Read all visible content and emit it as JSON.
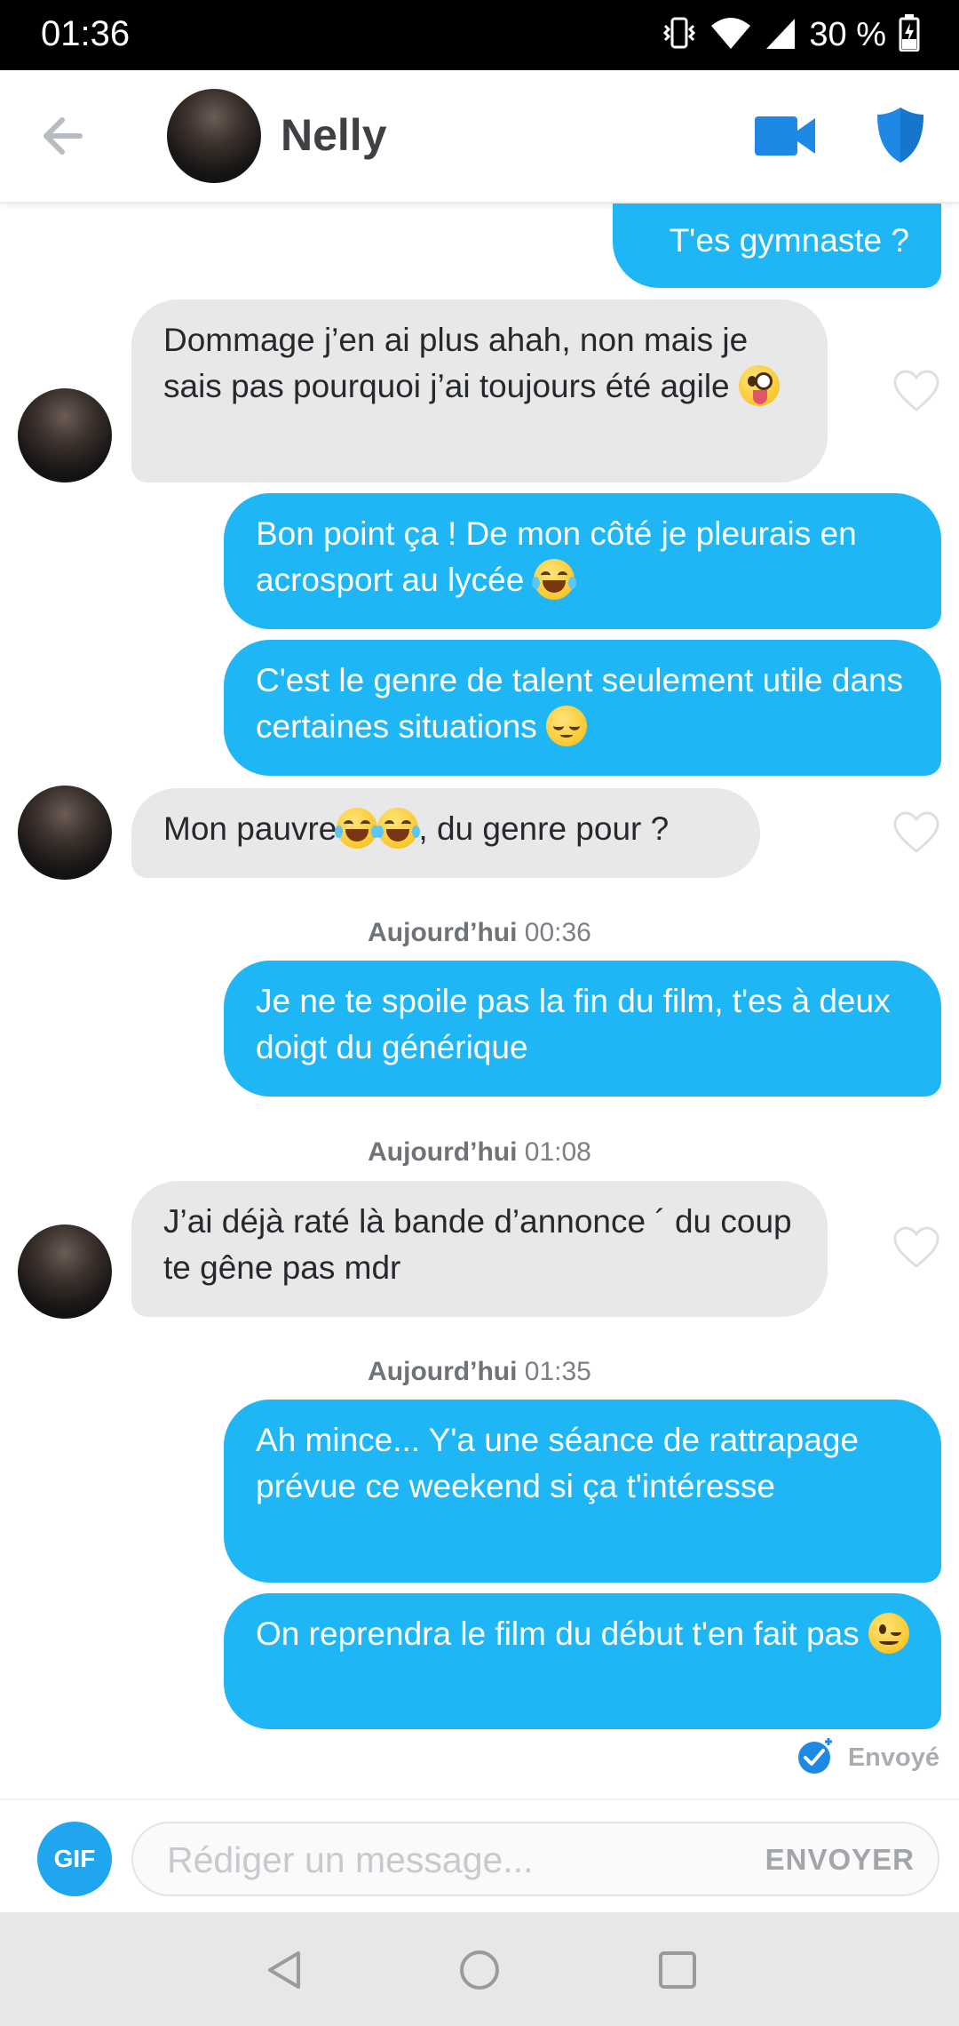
{
  "status_bar": {
    "time": "01:36",
    "battery": "30 %"
  },
  "header": {
    "contact_name": "Nelly"
  },
  "messages": [
    {
      "from": "me",
      "text": "T'es gymnaste ?"
    },
    {
      "from": "them",
      "text": "Dommage j’en ai plus ahah, non mais je sais pas pourquoi j’ai toujours été agile",
      "emoji": "zany-face"
    },
    {
      "from": "me",
      "text": "Bon point ça ! De mon côté je pleurais en acrosport au lycée",
      "emoji": "tears-of-joy"
    },
    {
      "from": "me",
      "text": "C'est le genre de talent seulement utile dans certaines situations",
      "emoji": "relieved-face"
    },
    {
      "from": "them",
      "text_before": "Mon pauvre",
      "text_after": ", du genre pour ?",
      "emoji": "tears-of-joy x2"
    },
    {
      "timestamp_day": "Aujourd’hui",
      "timestamp_time": "00:36"
    },
    {
      "from": "me",
      "text": "Je ne te spoile pas la fin du film, t'es à deux doigt du générique"
    },
    {
      "timestamp_day": "Aujourd’hui",
      "timestamp_time": "01:08"
    },
    {
      "from": "them",
      "text": "J’ai déjà raté là bande d’annonce ´ du coup te gêne pas mdr"
    },
    {
      "timestamp_day": "Aujourd’hui",
      "timestamp_time": "01:35"
    },
    {
      "from": "me",
      "text": "Ah mince... Y'a une séance de rattrapage prévue ce weekend si ça t'intéresse"
    },
    {
      "from": "me",
      "text": "On reprendra le film du début t'en fait pas",
      "emoji": "winking-face"
    }
  ],
  "sent_status": "Envoyé",
  "composer": {
    "gif_label": "GIF",
    "placeholder": "Rédiger un message...",
    "send_label": "ENVOYER"
  },
  "colors": {
    "outgoing_bubble": "#1fb6f5",
    "incoming_bubble": "#e8e8e8",
    "accent": "#1e88e5"
  }
}
